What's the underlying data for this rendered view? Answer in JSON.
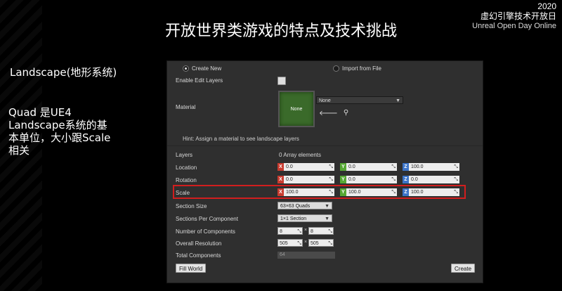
{
  "slide": {
    "title": "开放世界类游戏的特点及技术挑战",
    "year": "2020",
    "event_cn": "虚幻引擎技术开放日",
    "event_en": "Unreal Open Day Online",
    "left_title": "Landscape(地形系统)",
    "left_desc_lines": [
      "Quad 是UE4",
      "Landscape系统的基",
      "本单位，大小跟Scale",
      "相关"
    ]
  },
  "panel": {
    "create_new": "Create New",
    "import_from_file": "Import from File",
    "enable_edit_layers": "Enable Edit Layers",
    "material_label": "Material",
    "material_thumb": "None",
    "material_value": "None",
    "hint": "Hint: Assign a material to see landscape layers",
    "layers_label": "Layers",
    "layers_value": "0 Array elements",
    "location_label": "Location",
    "location": {
      "x": "0.0",
      "y": "0.0",
      "z": "100.0"
    },
    "rotation_label": "Rotation",
    "rotation": {
      "x": "0.0",
      "y": "0.0",
      "z": "0.0"
    },
    "scale_label": "Scale",
    "scale": {
      "x": "100.0",
      "y": "100.0",
      "z": "100.0"
    },
    "axis_x": "X",
    "axis_y": "Y",
    "axis_z": "Z",
    "section_size_label": "Section Size",
    "section_size": "63×63 Quads",
    "sections_per_component_label": "Sections Per Component",
    "sections_per_component": "1×1 Section",
    "num_components_label": "Number of Components",
    "num_components": {
      "x": "8",
      "y": "8"
    },
    "overall_resolution_label": "Overall Resolution",
    "overall_resolution": {
      "x": "505",
      "y": "505"
    },
    "total_components_label": "Total Components",
    "total_components": "64",
    "fill_world": "Fill World",
    "create": "Create"
  },
  "colors": {
    "highlight": "#d11e1e",
    "axis_x": "#c83b2f",
    "axis_y": "#56a834",
    "axis_z": "#3c74c8"
  }
}
